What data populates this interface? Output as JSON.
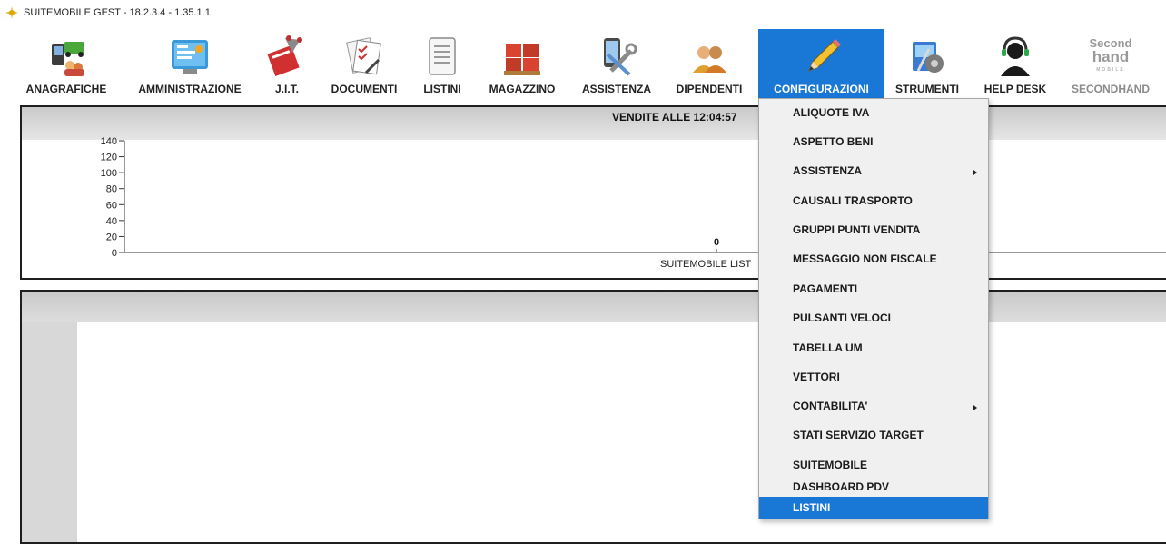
{
  "window": {
    "title": "SUITEMOBILE GEST - 18.2.3.4 - 1.35.1.1"
  },
  "toolbar": [
    {
      "label": "ANAGRAFICHE",
      "icon": "anagrafiche-icon"
    },
    {
      "label": "AMMINISTRAZIONE",
      "icon": "amministrazione-icon"
    },
    {
      "label": "J.I.T.",
      "icon": "jit-icon"
    },
    {
      "label": "DOCUMENTI",
      "icon": "documenti-icon"
    },
    {
      "label": "LISTINI",
      "icon": "listini-icon"
    },
    {
      "label": "MAGAZZINO",
      "icon": "magazzino-icon"
    },
    {
      "label": "ASSISTENZA",
      "icon": "assistenza-icon"
    },
    {
      "label": "DIPENDENTI",
      "icon": "dipendenti-icon"
    },
    {
      "label": "CONFIGURAZIONI",
      "icon": "pencil-icon",
      "active": true
    },
    {
      "label": "STRUMENTI",
      "icon": "strumenti-icon"
    },
    {
      "label": "HELP DESK",
      "icon": "headset-icon"
    },
    {
      "label": "SECONDHAND",
      "icon": "secondhand-logo",
      "disabled": true,
      "logo_text": [
        "Second",
        "hand",
        "MOBILE"
      ]
    }
  ],
  "chart_data": {
    "type": "bar",
    "title": "VENDITE ALLE 12:04:57",
    "categories": [
      "SUITEMOBILE LIST"
    ],
    "values": [
      0
    ],
    "data_labels": [
      "0"
    ],
    "yticks": [
      "140",
      "120",
      "100",
      "80",
      "60",
      "40",
      "20",
      "0"
    ],
    "ylim": [
      0,
      140
    ],
    "grid": false
  },
  "menu": {
    "items": [
      {
        "label": "ALIQUOTE IVA"
      },
      {
        "label": "ASPETTO BENI"
      },
      {
        "label": "ASSISTENZA",
        "submenu": true
      },
      {
        "label": "CAUSALI TRASPORTO"
      },
      {
        "label": "GRUPPI PUNTI VENDITA"
      },
      {
        "label": "MESSAGGIO NON FISCALE"
      },
      {
        "label": "PAGAMENTI"
      },
      {
        "label": "PULSANTI VELOCI"
      },
      {
        "label": "TABELLA UM"
      },
      {
        "label": "VETTORI"
      },
      {
        "label": "CONTABILITA'",
        "submenu": true
      },
      {
        "label": "STATI SERVIZIO TARGET"
      },
      {
        "label": "SUITEMOBILE"
      },
      {
        "label": "DASHBOARD PDV"
      },
      {
        "label": "LISTINI",
        "highlighted": true
      }
    ]
  },
  "colors": {
    "accent": "#1977d6",
    "panel_band": "#c9c9c9",
    "text": "#222222"
  }
}
